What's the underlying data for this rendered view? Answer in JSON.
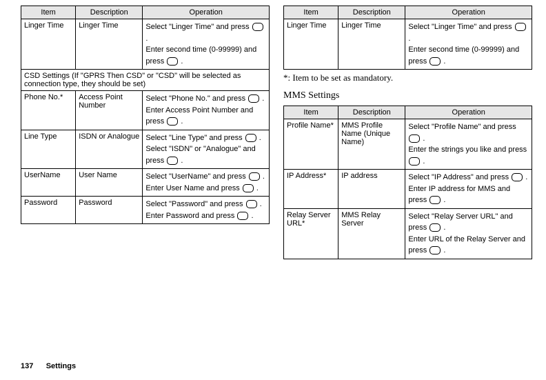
{
  "headers": {
    "item": "Item",
    "description": "Description",
    "operation": "Operation"
  },
  "left": {
    "rows": [
      {
        "item": "Linger Time",
        "desc": "Linger Time",
        "op": [
          "Select \"Linger Time\" and press ",
          " .",
          "Enter second time (0-99999) and press ",
          " ."
        ]
      },
      null,
      {
        "item": "Phone No.*",
        "desc": "Access Point Number",
        "op": [
          "Select \"Phone No.\" and press ",
          " .",
          "Enter Access Point Number and press ",
          " ."
        ]
      },
      {
        "item": "Line Type",
        "desc": "ISDN or Analogue",
        "op": [
          "Select \"Line Type\" and press ",
          " .",
          "Select \"ISDN\" or \"Analogue\" and press ",
          " ."
        ]
      },
      {
        "item": "UserName",
        "desc": "User Name",
        "op": [
          "Select \"UserName\" and press ",
          " .",
          "Enter User Name and press ",
          " ."
        ]
      },
      {
        "item": "Password",
        "desc": "Password",
        "op": [
          "Select \"Password\" and press ",
          " .",
          "Enter Password and press ",
          " ."
        ]
      }
    ],
    "section": "CSD Settings (If \"GPRS Then CSD\" or \"CSD\" will be selected as connection type, they should be set)"
  },
  "right": {
    "first": {
      "item": "Linger Time",
      "desc": "Linger Time",
      "op": [
        "Select \"Linger Time\" and press ",
        " .",
        "Enter second time (0-99999) and press ",
        " ."
      ]
    },
    "note": "*: Item to be set as mandatory.",
    "heading": "MMS Settings",
    "rows": [
      {
        "item": "Profile Name*",
        "desc": "MMS Profile Name (Unique Name)",
        "op": [
          "Select \"Profile Name\" and press ",
          " .",
          "Enter the strings you like and press ",
          " ."
        ]
      },
      {
        "item": "IP Address*",
        "desc": "IP address",
        "op": [
          "Select \"IP Address\" and press ",
          " .",
          "Enter IP address for MMS and press ",
          " ."
        ]
      },
      {
        "item": "Relay Server URL*",
        "desc": "MMS Relay Server",
        "op": [
          "Select \"Relay Server URL\" and press ",
          " .",
          "Enter URL of the Relay Server and press ",
          " ."
        ]
      }
    ]
  },
  "footer": {
    "page": "137",
    "title": "Settings"
  }
}
